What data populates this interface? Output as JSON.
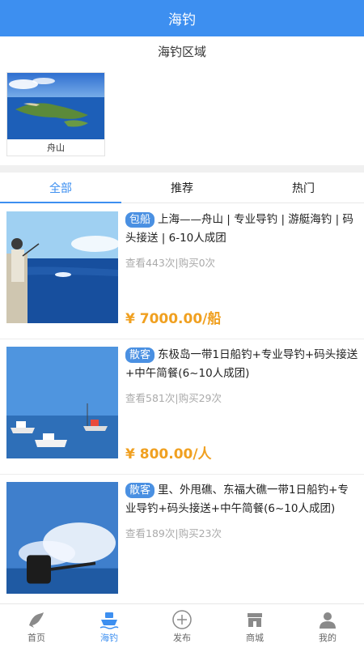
{
  "header": {
    "title": "海钓"
  },
  "region": {
    "title": "海钓区域",
    "cards": [
      {
        "label": "舟山"
      }
    ]
  },
  "tabs": [
    {
      "label": "全部",
      "active": true
    },
    {
      "label": "推荐",
      "active": false
    },
    {
      "label": "热门",
      "active": false
    }
  ],
  "items": [
    {
      "badge": "包船",
      "title": "上海——舟山 | 专业导钓 | 游艇海钓 | 码头接送 | 6-10人成团",
      "stats": "查看443次|购买0次",
      "price": "¥ 7000.00/船"
    },
    {
      "badge": "散客",
      "title": "东极岛一带1日船钓+专业导钓+码头接送+中午简餐(6~10人成团)",
      "stats": "查看581次|购买29次",
      "price": "¥ 800.00/人"
    },
    {
      "badge": "散客",
      "title": "里、外甩礁、东福大礁一带1日船钓+专业导钓+码头接送+中午简餐(6~10人成团)",
      "stats": "查看189次|购买23次",
      "price": ""
    }
  ],
  "tabbar": [
    {
      "label": "首页",
      "icon": "fish-icon",
      "active": false
    },
    {
      "label": "海钓",
      "icon": "boat-icon",
      "active": true
    },
    {
      "label": "发布",
      "icon": "plus-circle-icon",
      "active": false
    },
    {
      "label": "商城",
      "icon": "store-icon",
      "active": false
    },
    {
      "label": "我的",
      "icon": "person-icon",
      "active": false
    }
  ],
  "colors": {
    "accent": "#3d8ff0",
    "price": "#f0a020",
    "badge": "#4a90e2"
  }
}
